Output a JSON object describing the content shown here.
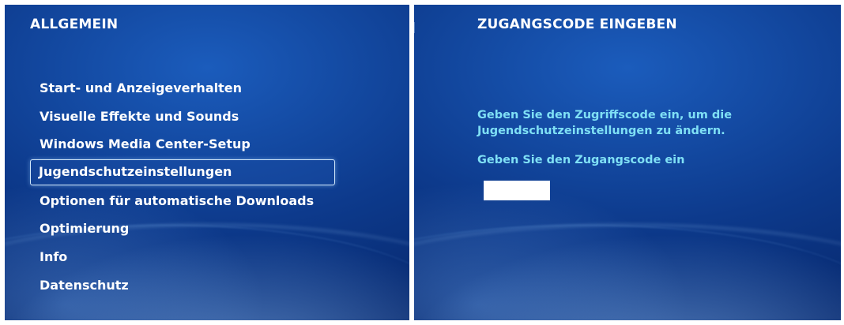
{
  "left_panel": {
    "title": "ALLGEMEIN",
    "menu": [
      {
        "label": "Start- und Anzeigeverhalten",
        "selected": false
      },
      {
        "label": "Visuelle Effekte und Sounds",
        "selected": false
      },
      {
        "label": "Windows Media Center-Setup",
        "selected": false
      },
      {
        "label": "Jugendschutzeinstellungen",
        "selected": true
      },
      {
        "label": "Optionen für automatische Downloads",
        "selected": false
      },
      {
        "label": "Optimierung",
        "selected": false
      },
      {
        "label": "Info",
        "selected": false
      },
      {
        "label": "Datenschutz",
        "selected": false
      }
    ]
  },
  "right_panel": {
    "title": "ZUGANGSCODE EINGEBEN",
    "prompt_main": "Geben Sie den Zugriffscode ein, um die Jugendschutzeinstellungen zu ändern.",
    "prompt_sub": "Geben Sie den Zugangscode ein",
    "code_value": ""
  },
  "colors": {
    "background_top": "#1b5cbc",
    "background_bottom": "#06266a",
    "title_text": "#ffffff",
    "prompt_text": "#7fe0f5"
  }
}
